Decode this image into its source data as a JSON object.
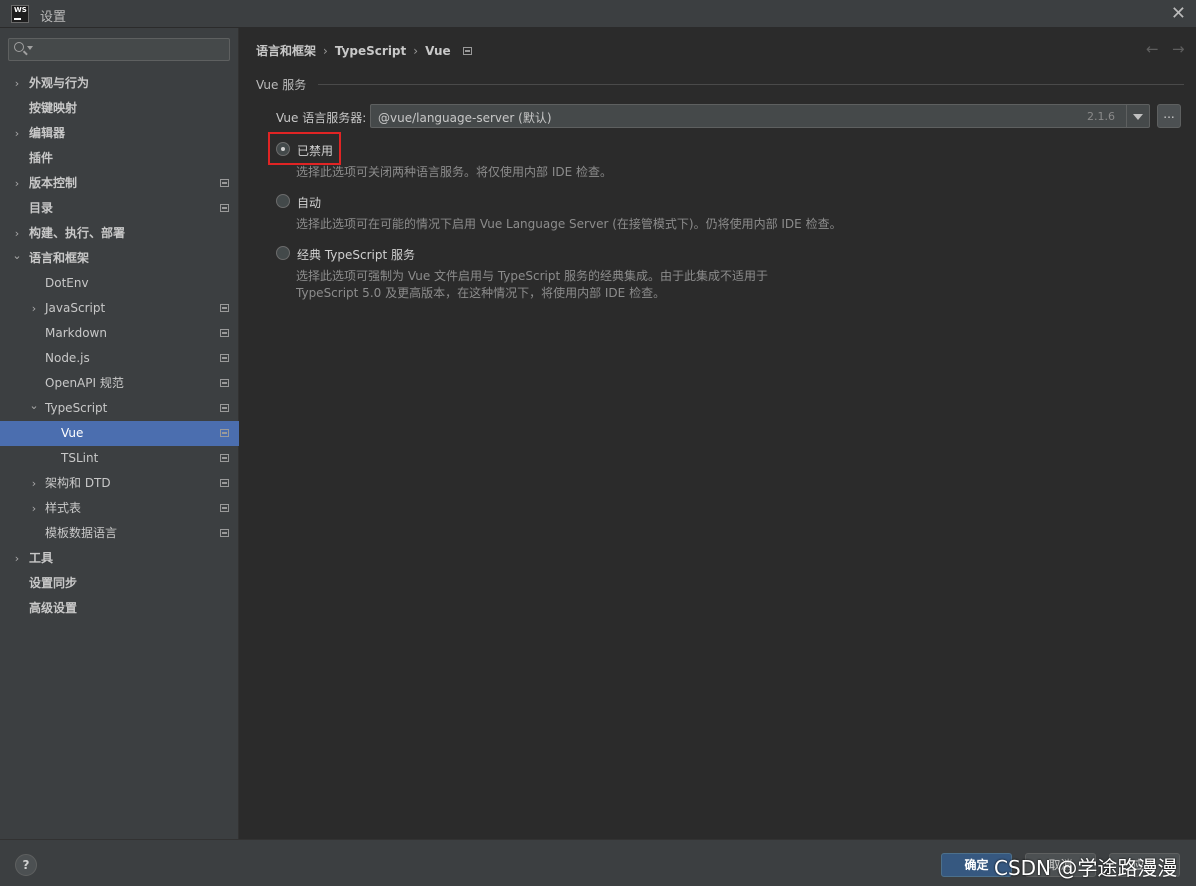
{
  "window": {
    "logo_text": "WS",
    "title": "设置",
    "close_icon": "close-icon"
  },
  "search": {
    "placeholder": ""
  },
  "sidebar": {
    "items": [
      {
        "label": "外观与行为",
        "arrow": "›",
        "level": 0,
        "project": false
      },
      {
        "label": "按键映射",
        "arrow": "",
        "level": 0,
        "project": false
      },
      {
        "label": "编辑器",
        "arrow": "›",
        "level": 0,
        "project": false
      },
      {
        "label": "插件",
        "arrow": "",
        "level": 0,
        "project": false
      },
      {
        "label": "版本控制",
        "arrow": "›",
        "level": 0,
        "project": true
      },
      {
        "label": "目录",
        "arrow": "",
        "level": 0,
        "project": true
      },
      {
        "label": "构建、执行、部署",
        "arrow": "›",
        "level": 0,
        "project": false
      },
      {
        "label": "语言和框架",
        "arrow": "⌄",
        "level": 0,
        "project": false
      },
      {
        "label": "DotEnv",
        "arrow": "",
        "level": 1,
        "project": false
      },
      {
        "label": "JavaScript",
        "arrow": "›",
        "level": 1,
        "project": true
      },
      {
        "label": "Markdown",
        "arrow": "",
        "level": 1,
        "project": true
      },
      {
        "label": "Node.js",
        "arrow": "",
        "level": 1,
        "project": true
      },
      {
        "label": "OpenAPI 规范",
        "arrow": "",
        "level": 1,
        "project": true
      },
      {
        "label": "TypeScript",
        "arrow": "⌄",
        "level": 1,
        "project": true
      },
      {
        "label": "Vue",
        "arrow": "",
        "level": 2,
        "project": true,
        "selected": true
      },
      {
        "label": "TSLint",
        "arrow": "",
        "level": 2,
        "project": true
      },
      {
        "label": "架构和 DTD",
        "arrow": "›",
        "level": 1,
        "project": true
      },
      {
        "label": "样式表",
        "arrow": "›",
        "level": 1,
        "project": true
      },
      {
        "label": "模板数据语言",
        "arrow": "",
        "level": 1,
        "project": true
      },
      {
        "label": "工具",
        "arrow": "›",
        "level": 0,
        "project": false
      },
      {
        "label": "设置同步",
        "arrow": "",
        "level": 0,
        "project": false
      },
      {
        "label": "高级设置",
        "arrow": "",
        "level": 0,
        "project": false
      }
    ]
  },
  "breadcrumb": {
    "items": [
      "语言和框架",
      "TypeScript",
      "Vue"
    ],
    "separator": "›",
    "back_icon": "←",
    "forward_icon": "→"
  },
  "main": {
    "section_title": "Vue 服务",
    "server_label": "Vue 语言服务器:",
    "server_value": "@vue/language-server (默认)",
    "server_version": "2.1.6",
    "browse_label": "...",
    "options": [
      {
        "label": "已禁用",
        "checked": true,
        "desc": [
          "选择此选项可关闭两种语言服务。将仅使用内部 IDE 检查。"
        ]
      },
      {
        "label": "自动",
        "checked": false,
        "desc": [
          "选择此选项可在可能的情况下启用 Vue Language Server (在接管模式下)。仍将使用内部 IDE 检查。"
        ]
      },
      {
        "label": "经典 TypeScript 服务",
        "checked": false,
        "desc": [
          "选择此选项可强制为 Vue 文件启用与 TypeScript 服务的经典集成。由于此集成不适用于",
          "TypeScript 5.0 及更高版本，在这种情况下，将使用内部 IDE 检查。"
        ]
      }
    ]
  },
  "footer": {
    "help_label": "?",
    "ok_label": "确定",
    "cancel_label": "取消",
    "apply_label": "应用",
    "watermark": "CSDN @学途路漫漫"
  },
  "colors": {
    "selection": "#4b6eaf",
    "highlight_box": "#e02424",
    "ok_button": "#365880"
  }
}
